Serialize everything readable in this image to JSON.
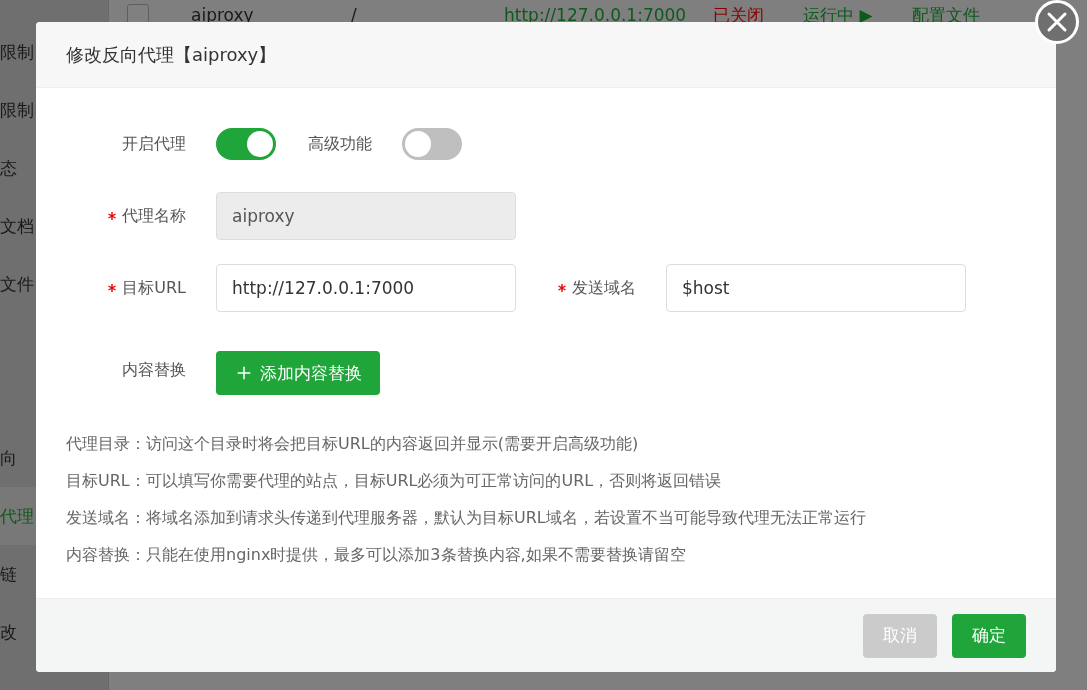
{
  "background": {
    "sidebar": [
      {
        "label": "限制",
        "selected": false
      },
      {
        "label": "限制",
        "selected": false
      },
      {
        "label": "态",
        "selected": false
      },
      {
        "label": "文档",
        "selected": false
      },
      {
        "label": "文件",
        "selected": false
      },
      {
        "label": "向",
        "selected": false
      },
      {
        "label": "代理",
        "selected": true
      },
      {
        "label": "链",
        "selected": false
      },
      {
        "label": "改",
        "selected": false
      }
    ],
    "table_row": {
      "checked": false,
      "cells": [
        {
          "text": "aiproxy",
          "color": "#1a1a1a"
        },
        {
          "text": "/",
          "color": "#1a1a1a"
        },
        {
          "text": "http://127.0.0.1:7000",
          "color": "#0e5a1c"
        },
        {
          "text": "已关闭",
          "color": "#8a0000"
        },
        {
          "text": "运行中 ▶",
          "color": "#0e5a1c"
        },
        {
          "text": "配置文件",
          "color": "#0e5a1c"
        }
      ]
    }
  },
  "dialog": {
    "title": "修改反向代理【aiproxy】",
    "toggles": [
      {
        "label": "开启代理",
        "on": true
      },
      {
        "label": "高级功能",
        "on": false
      }
    ],
    "name_field": {
      "label": "代理名称",
      "required": true,
      "value": "aiproxy",
      "disabled": true
    },
    "url_fields": [
      {
        "label": "目标URL",
        "required": true,
        "value": "http://127.0.0.1:7000"
      },
      {
        "label": "发送域名",
        "required": true,
        "value": "$host"
      }
    ],
    "replace": {
      "label": "内容替换",
      "button": "添加内容替换"
    },
    "notes": [
      "代理目录：访问这个目录时将会把目标URL的内容返回并显示(需要开启高级功能)",
      "目标URL：可以填写你需要代理的站点，目标URL必须为可正常访问的URL，否则将返回错误",
      "发送域名：将域名添加到请求头传递到代理服务器，默认为目标URL域名，若设置不当可能导致代理无法正常运行",
      "内容替换：只能在使用nginx时提供，最多可以添加3条替换内容,如果不需要替换请留空"
    ],
    "buttons": [
      {
        "label": "取消",
        "kind": "cancel"
      },
      {
        "label": "确定",
        "kind": "primary"
      }
    ]
  }
}
